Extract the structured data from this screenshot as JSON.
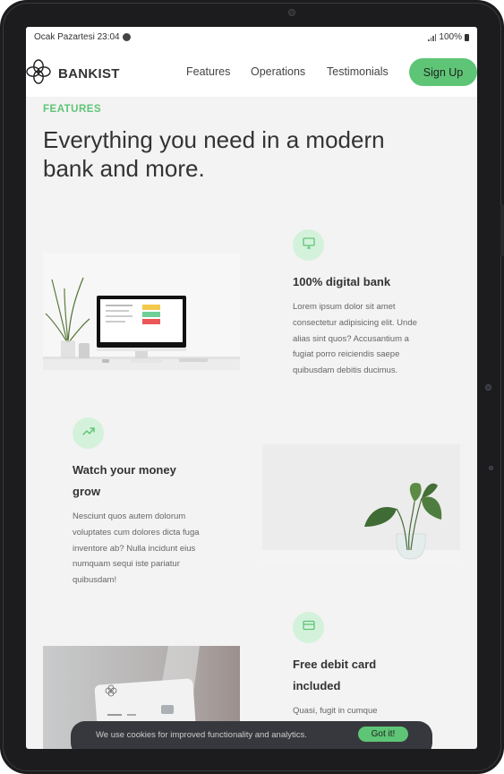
{
  "status": {
    "left_text": "Ocak Pazartesi 23:04",
    "right_text": "100%"
  },
  "nav": {
    "brand": "BANKIST",
    "links": [
      "Features",
      "Operations",
      "Testimonials"
    ],
    "cta": "Sign Up"
  },
  "section": {
    "label": "FEATURES",
    "heading": "Everything you need in a modern bank and more."
  },
  "features": [
    {
      "icon": "monitor-icon",
      "title": "100% digital bank",
      "text": "Lorem ipsum dolor sit amet consectetur adipisicing elit. Unde alias sint quos? Accusantium a fugiat porro reiciendis saepe quibusdam debitis ducimus."
    },
    {
      "icon": "trending-up-icon",
      "title": "Watch your money grow",
      "text": "Nesciunt quos autem dolorum voluptates cum dolores dicta fuga inventore ab? Nulla incidunt eius numquam sequi iste pariatur quibusdam!"
    },
    {
      "icon": "credit-card-icon",
      "title": "Free debit card included",
      "text": "Quasi, fugit in cumque"
    }
  ],
  "cookie": {
    "message": "We use cookies for improved functionality and analytics.",
    "button": "Got it!"
  },
  "colors": {
    "accent": "#5ec576",
    "accent_light": "#d4f2db",
    "text": "#333333",
    "background": "#f3f3f3"
  }
}
